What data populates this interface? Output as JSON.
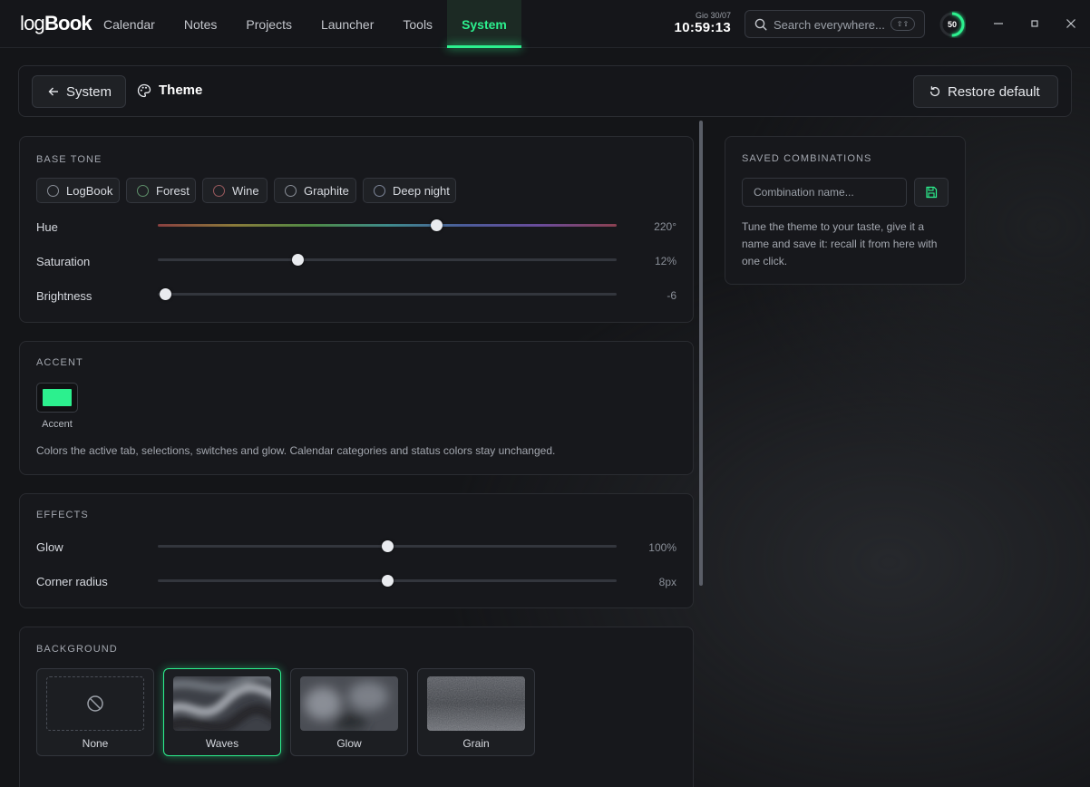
{
  "app": {
    "logo_light": "log",
    "logo_bold": "Book"
  },
  "nav": {
    "items": [
      {
        "label": "Calendar"
      },
      {
        "label": "Notes"
      },
      {
        "label": "Projects"
      },
      {
        "label": "Launcher"
      },
      {
        "label": "Tools"
      },
      {
        "label": "System",
        "active": true
      }
    ]
  },
  "clock": {
    "date": "Gio 30/07",
    "time": "10:59:13"
  },
  "search": {
    "placeholder": "Search everywhere...",
    "shortcut": "⇧⇧"
  },
  "progress_ring": {
    "value": 50,
    "label": "50"
  },
  "header": {
    "back_label": "System",
    "title": "Theme",
    "restore_label": "Restore default"
  },
  "base_tone": {
    "title": "BASE TONE",
    "presets": [
      {
        "label": "LogBook",
        "dot_color": "#8a8f98"
      },
      {
        "label": "Forest",
        "dot_color": "#5e8f6a"
      },
      {
        "label": "Wine",
        "dot_color": "#9a5a5e"
      },
      {
        "label": "Graphite",
        "dot_color": "#8a8f98"
      },
      {
        "label": "Deep night",
        "dot_color": "#7d8598"
      }
    ],
    "sliders": [
      {
        "label": "Hue",
        "value_text": "220°",
        "fraction": 0.607
      },
      {
        "label": "Saturation",
        "value_text": "12%",
        "fraction": 0.305
      },
      {
        "label": "Brightness",
        "value_text": "-6",
        "fraction": 0.015
      }
    ]
  },
  "accent": {
    "title": "ACCENT",
    "swatch_label": "Accent",
    "color": "#2cf08e",
    "description": "Colors the active tab, selections, switches and glow. Calendar categories and status colors stay unchanged."
  },
  "effects": {
    "title": "EFFECTS",
    "sliders": [
      {
        "label": "Glow",
        "value_text": "100%",
        "fraction": 0.5
      },
      {
        "label": "Corner radius",
        "value_text": "8px",
        "fraction": 0.5
      }
    ]
  },
  "background": {
    "title": "BACKGROUND",
    "options": [
      {
        "label": "None",
        "icon": "prohibited-icon",
        "selected": false
      },
      {
        "label": "Waves",
        "selected": true
      },
      {
        "label": "Glow",
        "selected": false
      },
      {
        "label": "Grain",
        "selected": false
      }
    ]
  },
  "saved_combinations": {
    "title": "SAVED COMBINATIONS",
    "placeholder": "Combination name...",
    "description": "Tune the theme to your taste, give it a name and save it: recall it from here with one click."
  }
}
